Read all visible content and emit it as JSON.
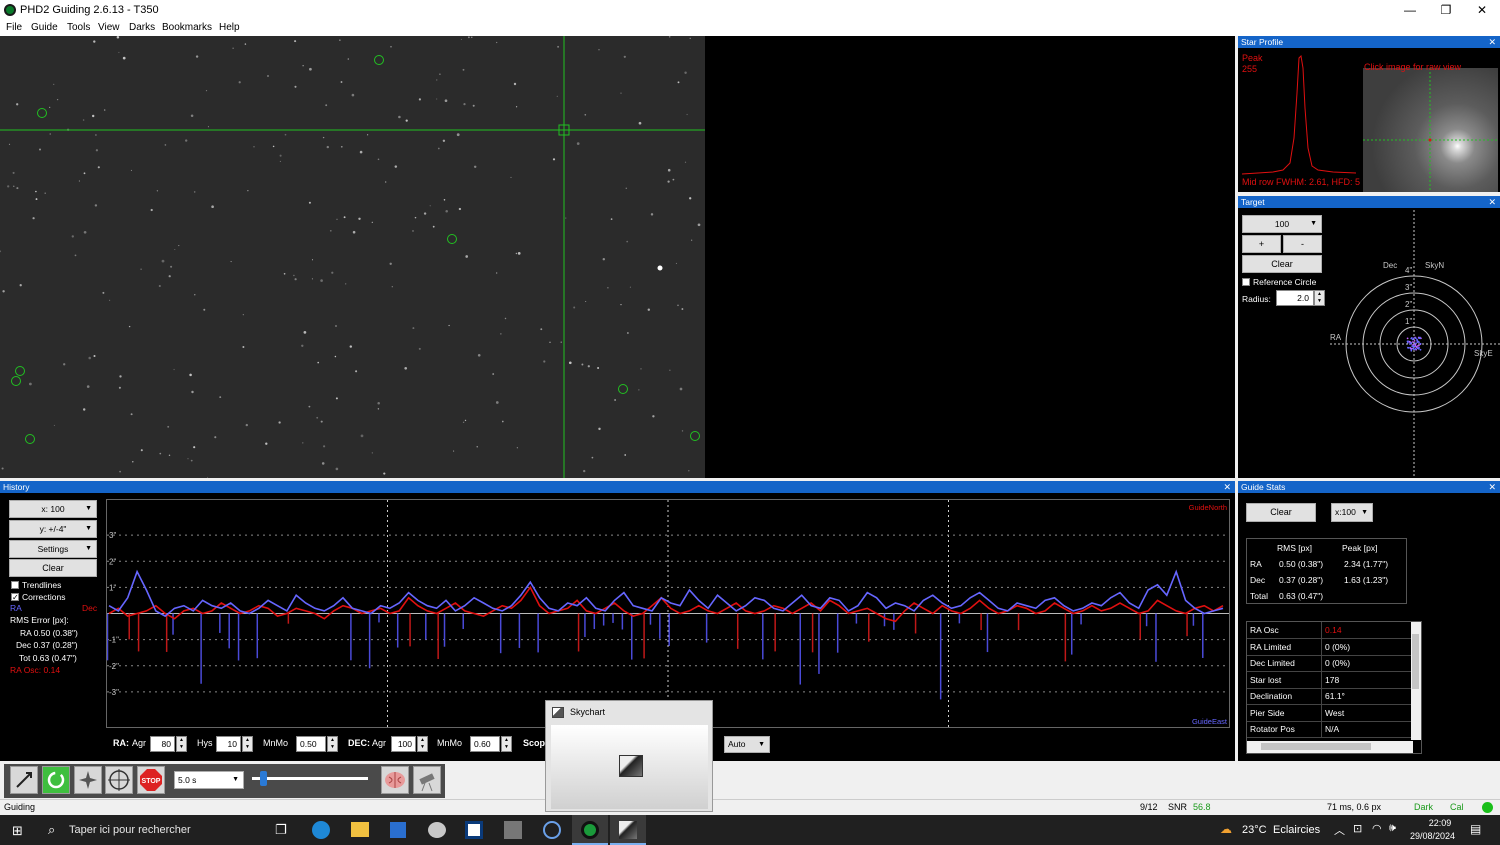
{
  "window": {
    "title": "PHD2 Guiding 2.6.13 - T350",
    "minimize": "—",
    "maximize": "❐",
    "close": "✕"
  },
  "menu": [
    "File",
    "Guide",
    "Tools",
    "View",
    "Darks",
    "Bookmarks",
    "Help"
  ],
  "star_profile": {
    "title": "Star Profile",
    "peak_label": "Peak",
    "peak_value": "255",
    "hint": "Click image for raw view",
    "fwhm": "Mid row FWHM: 2.61, HFD: 5"
  },
  "target": {
    "title": "Target",
    "scale": "100",
    "plus": "+",
    "minus": "-",
    "clear": "Clear",
    "reference_circle": "Reference Circle",
    "radius_label": "Radius:",
    "radius_value": "2.0",
    "labels": {
      "dec": "Dec",
      "skyn": "SkyN",
      "ra": "RA",
      "skye": "SkyE"
    },
    "rings": [
      "4\"",
      "3\"",
      "2\"",
      "1\""
    ]
  },
  "history": {
    "title": "History",
    "x_scale": "x: 100",
    "y_scale": "y: +/-4\"",
    "settings": "Settings",
    "clear": "Clear",
    "trendlines": "Trendlines",
    "corrections": "Corrections",
    "ra_label": "RA",
    "dec_label": "Dec",
    "rms_title": "RMS Error [px]:",
    "rms_ra": "RA  0.50 (0.38\")",
    "rms_dec": "Dec  0.37 (0.28\")",
    "rms_tot": "Tot  0.63 (0.47\")",
    "ra_osc": "RA Osc: 0.14",
    "guide_north": "GuideNorth",
    "guide_east": "GuideEast",
    "y_ticks": [
      "3\"",
      "2\"",
      "1\"",
      "-1\"",
      "-2\"",
      "-3\""
    ]
  },
  "guide_params": {
    "ra_label": "RA:",
    "agr_label": "Agr",
    "ra_agr": "80",
    "hys_label": "Hys",
    "hys": "10",
    "mnmo_label": "MnMo",
    "ra_mnmo": "0.50",
    "dec_label": "DEC:",
    "dec_agr": "100",
    "dec_mnmo": "0.60",
    "scope_label": "Scop",
    "dec_mode": "Auto"
  },
  "guide_stats": {
    "title": "Guide Stats",
    "clear": "Clear",
    "x_scale": "x:100",
    "headers": [
      "",
      "RMS [px]",
      "Peak [px]"
    ],
    "rows": [
      [
        "RA",
        "0.50 (0.38\")",
        "2.34 (1.77\")"
      ],
      [
        "Dec",
        "0.37 (0.28\")",
        "1.63 (1.23\")"
      ],
      [
        "Total",
        "0.63 (0.47\")",
        ""
      ]
    ],
    "details": [
      [
        "RA Osc",
        "0.14"
      ],
      [
        "RA Limited",
        "0 (0%)"
      ],
      [
        "Dec Limited",
        "0 (0%)"
      ],
      [
        "Star lost",
        "178"
      ],
      [
        "Declination",
        "61.1°"
      ],
      [
        "Pier Side",
        "West"
      ],
      [
        "Rotator Pos",
        "N/A"
      ]
    ]
  },
  "toolbar": {
    "exposure": "5.0 s",
    "stop": "STOP"
  },
  "status": {
    "state": "Guiding",
    "frames": "9/12",
    "snr_label": "SNR",
    "snr": "56.8",
    "timing": "71 ms, 0.6 px",
    "dark": "Dark",
    "cal": "Cal"
  },
  "skychart_popup": {
    "title": "Skychart"
  },
  "taskbar": {
    "search": "Taper ici pour rechercher",
    "temp": "23°C",
    "weather": "Eclaircies",
    "time": "22:09",
    "date": "29/08/2024"
  },
  "chart_data": {
    "type": "line",
    "ylim": [
      -4,
      4
    ],
    "series": [
      {
        "name": "RA",
        "color": "#6666ff",
        "values": [
          0.3,
          0.1,
          0.6,
          1.6,
          0.9,
          0.1,
          -0.1,
          0.2,
          0.3,
          0.1,
          0.5,
          0.3,
          0.2,
          0.4,
          0.1,
          0.0,
          0.2,
          0.5,
          0.3,
          0.1,
          0.7,
          0.4,
          0.2,
          0.1,
          0.3,
          0.6,
          0.2,
          0.1,
          0.0,
          0.3,
          0.2,
          0.4,
          0.8,
          0.5,
          0.3,
          0.2,
          0.5,
          0.1,
          0.3,
          0.6,
          0.4,
          0.2,
          0.1,
          0.3,
          0.7,
          1.2,
          0.6,
          0.2,
          0.1,
          0.4,
          0.3,
          0.6,
          0.2,
          0.1,
          0.5,
          0.8,
          0.3,
          0.2,
          0.1,
          0.6,
          0.4,
          0.3,
          0.9,
          0.5,
          0.2,
          0.7,
          0.4,
          0.1,
          0.3,
          0.6,
          0.5,
          0.2,
          0.1,
          0.4,
          0.7,
          0.3,
          0.2,
          0.6,
          0.5,
          0.1,
          0.3,
          0.8,
          0.6,
          0.2,
          0.4,
          0.3,
          0.1,
          0.5,
          0.7,
          0.4,
          0.2,
          0.3,
          0.6,
          0.8,
          0.5,
          0.2,
          0.1,
          0.4,
          0.3,
          0.2,
          0.5,
          0.6,
          0.3,
          0.1,
          0.2,
          0.4,
          0.3,
          0.6,
          0.8,
          0.4,
          0.2,
          0.9,
          1.1,
          0.7,
          1.6,
          0.5,
          0.2,
          0.0,
          0.1,
          0.2
        ]
      },
      {
        "name": "Dec",
        "color": "#e01010",
        "values": [
          0.0,
          0.2,
          -0.1,
          0.0,
          0.1,
          0.3,
          0.0,
          -0.2,
          0.1,
          0.2,
          0.0,
          0.1,
          0.4,
          0.2,
          0.0,
          0.1,
          0.3,
          0.2,
          -0.1,
          0.0,
          0.2,
          0.1,
          0.0,
          -0.2,
          0.1,
          0.3,
          0.2,
          0.0,
          0.1,
          0.2,
          0.0,
          0.1,
          0.6,
          0.3,
          0.1,
          0.0,
          0.2,
          0.4,
          0.1,
          0.0,
          -0.1,
          0.1,
          0.3,
          0.2,
          0.5,
          1.0,
          0.3,
          0.0,
          0.1,
          0.2,
          0.5,
          0.1,
          0.0,
          0.2,
          0.4,
          0.1,
          -0.1,
          0.0,
          0.3,
          0.6,
          0.2,
          0.0,
          0.1,
          0.3,
          0.1,
          0.0,
          0.2,
          0.4,
          0.1,
          0.0,
          0.1,
          0.3,
          0.2,
          0.0,
          0.2,
          0.4,
          0.1,
          0.5,
          0.3,
          0.0,
          0.1,
          0.2,
          0.0,
          -0.2,
          -0.3,
          0.1,
          0.4,
          0.2,
          0.0,
          0.3,
          0.1,
          0.0,
          0.2,
          0.5,
          0.2,
          0.0,
          0.1,
          0.3,
          0.2,
          0.0,
          0.1,
          0.4,
          0.2,
          0.0,
          0.1,
          0.3,
          0.1,
          0.2,
          0.4,
          0.2,
          0.0,
          0.1,
          0.5,
          0.3,
          0.1,
          0.0,
          0.2,
          0.3,
          0.1,
          0.3
        ]
      }
    ]
  }
}
